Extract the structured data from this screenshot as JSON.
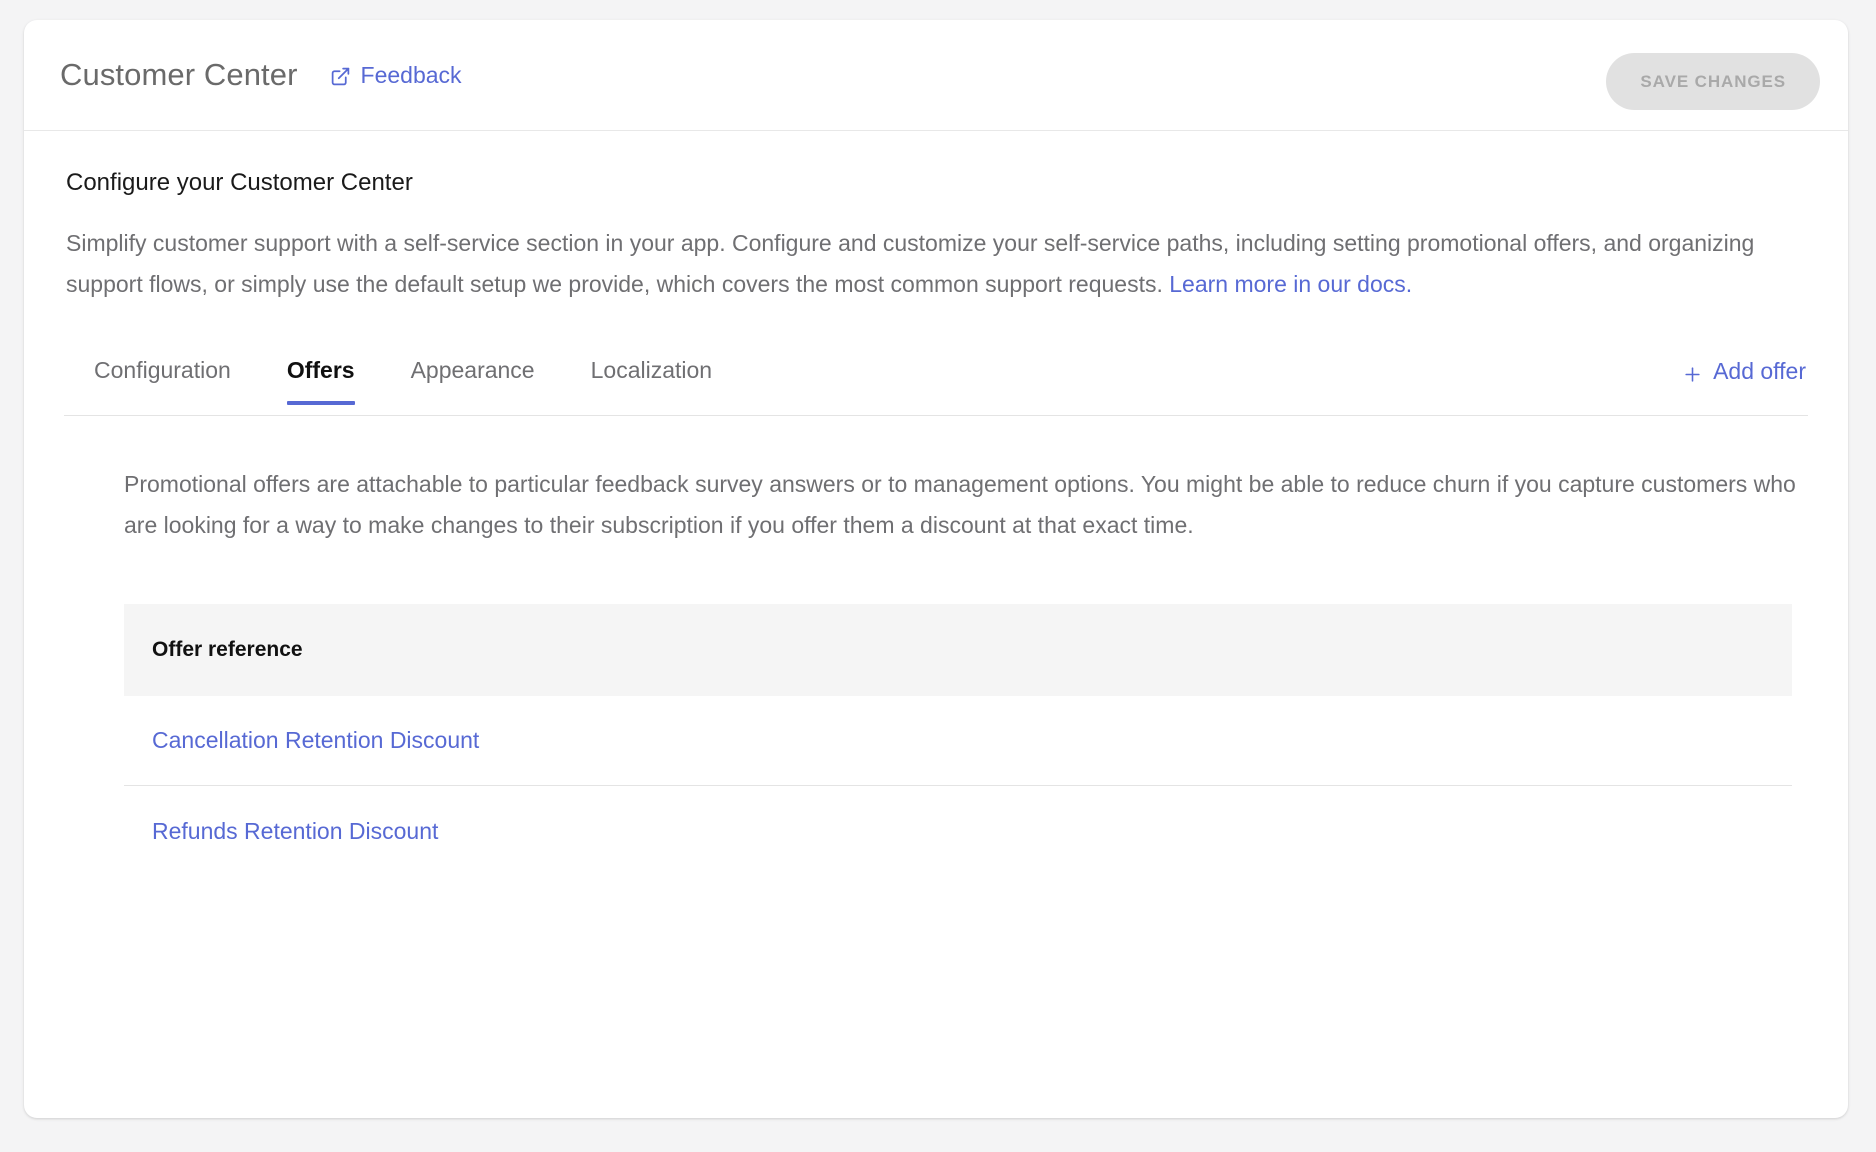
{
  "header": {
    "title": "Customer Center",
    "feedback_label": "Feedback",
    "feedback_icon": "external-link-icon",
    "save_label": "SAVE CHANGES"
  },
  "intro": {
    "title": "Configure your Customer Center",
    "description": "Simplify customer support with a self-service section in your app. Configure and customize your self-service paths, including setting promotional offers, and organizing support flows, or simply use the default setup we provide, which covers the most common support requests. ",
    "link_label": "Learn more in our docs."
  },
  "tabs": {
    "items": [
      {
        "label": "Configuration",
        "active": false
      },
      {
        "label": "Offers",
        "active": true
      },
      {
        "label": "Appearance",
        "active": false
      },
      {
        "label": "Localization",
        "active": false
      }
    ],
    "add_offer_label": "Add offer",
    "add_offer_icon": "plus-icon"
  },
  "offers_panel": {
    "description": "Promotional offers are attachable to particular feedback survey answers or to management options. You might be able to reduce churn if you capture customers who are looking for a way to make changes to their subscription if you offer them a discount at that exact time.",
    "table": {
      "columns": [
        "Offer reference"
      ],
      "rows": [
        {
          "offer_reference": "Cancellation Retention Discount"
        },
        {
          "offer_reference": "Refunds Retention Discount"
        }
      ]
    }
  },
  "colors": {
    "accent": "#5769d4",
    "page_background": "#f4f4f5",
    "card_background": "#ffffff",
    "muted_text": "#6f6f72",
    "table_head_background": "#f5f5f5",
    "disabled_button_background": "#e1e1e1",
    "disabled_button_text": "#a9a9a9"
  }
}
